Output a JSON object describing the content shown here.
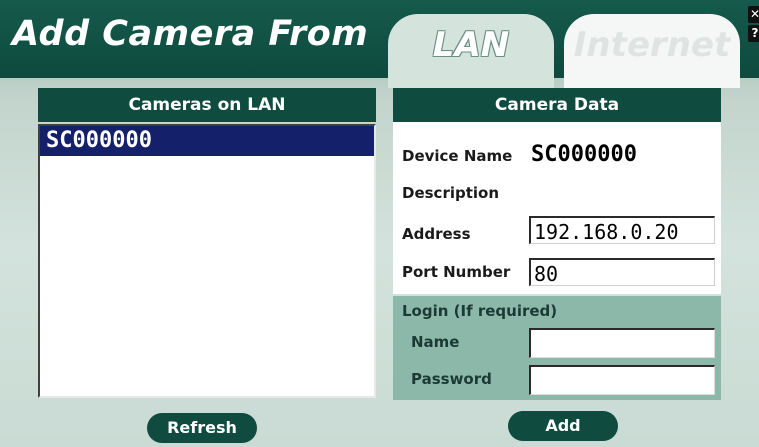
{
  "header": {
    "title": "Add Camera From",
    "tabs": [
      {
        "label": "LAN",
        "active": true
      },
      {
        "label": "Internet",
        "active": false
      }
    ],
    "close_glyph": "✕",
    "help_glyph": "?"
  },
  "cameras_panel": {
    "heading": "Cameras on LAN",
    "items": [
      "SC000000"
    ],
    "selected_index": 0
  },
  "camera_data": {
    "heading": "Camera Data",
    "device_name_label": "Device Name",
    "device_name_value": "SC000000",
    "description_label": "Description",
    "address_label": "Address",
    "address_value": "192.168.0.20",
    "port_label": "Port Number",
    "port_value": "80"
  },
  "login": {
    "title": "Login (If required)",
    "name_label": "Name",
    "name_value": "",
    "password_label": "Password",
    "password_value": ""
  },
  "buttons": {
    "refresh_label": "Refresh",
    "add_label": "Add"
  },
  "colors": {
    "header": "#0e4a3e",
    "panel_dark": "#0f4b3f",
    "login_bg": "#8cb8aa",
    "selection": "#14206a"
  }
}
